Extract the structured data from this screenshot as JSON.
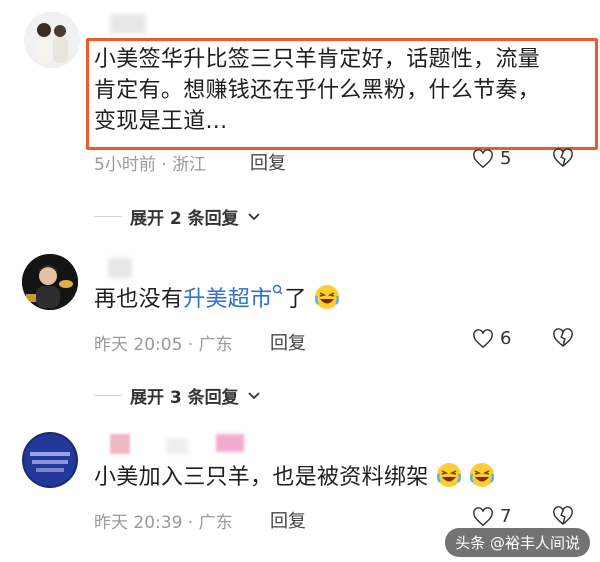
{
  "comments": [
    {
      "text_line1": "小美签华升比签三只羊肯定好，话题性，流量",
      "text_line2": "肯定有。想赚钱还在乎什么黑粉，什么节奏，",
      "text_line3": "变现是王道...",
      "time_location": "5小时前 · 浙江",
      "reply_label": "回复",
      "like_count": "5"
    },
    {
      "text_prefix": "再也没有",
      "text_link": "升美超市",
      "text_suffix": "了",
      "time_location": "昨天 20:05 · 广东",
      "reply_label": "回复",
      "like_count": "6"
    },
    {
      "text": "小美加入三只羊，也是被资料绑架",
      "time_location": "昨天 20:39 · 广东",
      "reply_label": "回复",
      "like_count": "7"
    }
  ],
  "expand_replies": [
    {
      "label": "展开 2 条回复"
    },
    {
      "label": "展开 3 条回复"
    }
  ],
  "watermark": "头条 @裕丰人间说",
  "colors": {
    "highlight_border": "#f05a28",
    "link": "#2f6fd6",
    "meta": "#9a9a9a"
  }
}
